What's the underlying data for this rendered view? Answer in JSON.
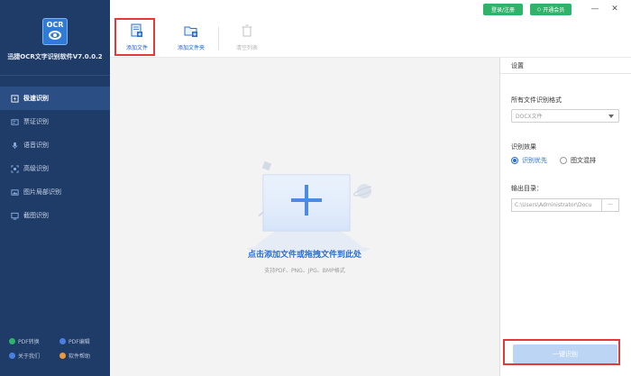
{
  "app": {
    "logo_text": "OCR",
    "title": "迅捷OCR文字识别软件V7.0.0.2"
  },
  "titlebar": {
    "login_label": "登录/注册",
    "vip_label": "开通会员",
    "minimize": "—",
    "close": "✕"
  },
  "sidebar": {
    "items": [
      {
        "label": "极速识别",
        "icon": "lightning-icon"
      },
      {
        "label": "票证识别",
        "icon": "card-icon"
      },
      {
        "label": "语音识别",
        "icon": "microphone-icon"
      },
      {
        "label": "高级识别",
        "icon": "scan-icon"
      },
      {
        "label": "图片局部识别",
        "icon": "image-crop-icon"
      },
      {
        "label": "截图识别",
        "icon": "screenshot-icon"
      }
    ],
    "footer": [
      {
        "label": "PDF转换",
        "color": "#2fb26a"
      },
      {
        "label": "PDF编辑",
        "color": "#4a7fe0"
      },
      {
        "label": "关于我们",
        "color": "#4a7fe0"
      },
      {
        "label": "软件帮助",
        "color": "#e89a3c"
      }
    ]
  },
  "toolbar": {
    "add_file": "添加文件",
    "add_folder": "添加文件夹",
    "clear_list": "清空列表"
  },
  "main": {
    "drop_title": "点击添加文件或拖拽文件到此处",
    "drop_sub": "支持PDF、PNG、JPG、BMP格式"
  },
  "settings": {
    "header": "设置",
    "format_label": "所有文件识别格式",
    "format_value": "DOCX文件",
    "effect_label": "识别效果",
    "effect_options": [
      "识别优先",
      "图文混排"
    ],
    "output_label": "输出目录：",
    "output_path": "C:\\Users\\Administrator\\Docu",
    "browse_label": "···",
    "go_label": "一键识别"
  },
  "colors": {
    "sidebar_bg": "#1f3b67",
    "accent": "#2a6fd1",
    "green": "#2fb26a",
    "highlight": "#e53935"
  }
}
